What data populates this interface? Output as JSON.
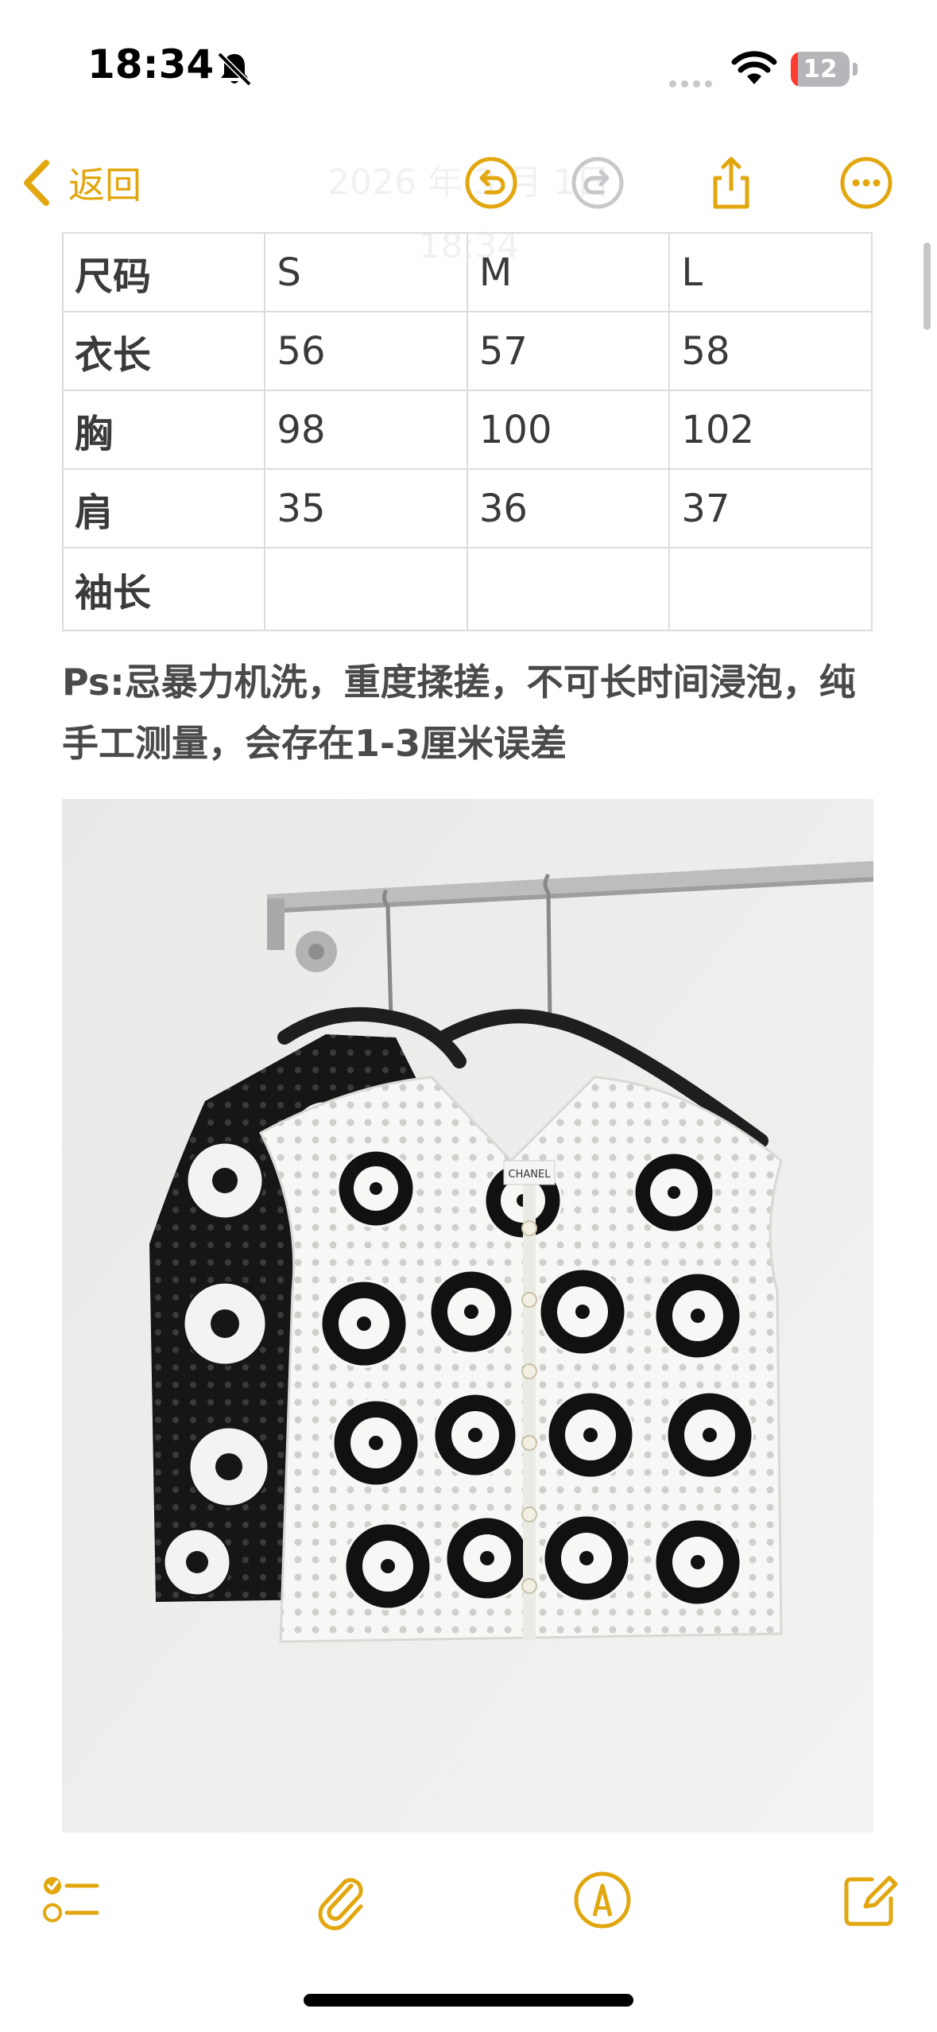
{
  "status_bar": {
    "time": "18:34",
    "battery_level": "12",
    "battery_fraction": 0.12,
    "icons": [
      "bell-slash-icon",
      "cellular-signal-icon",
      "wifi-icon",
      "battery-icon"
    ]
  },
  "nav": {
    "back_label": "返回",
    "faded_date": "2026 年 3 月 1日 18:34",
    "icons": [
      "undo-icon",
      "redo-icon",
      "share-icon",
      "more-icon"
    ]
  },
  "size_table": {
    "header": [
      "尺码",
      "S",
      "M",
      "L"
    ],
    "rows": [
      [
        "衣长",
        "56",
        "57",
        "58"
      ],
      [
        "胸",
        "98",
        "100",
        "102"
      ],
      [
        "肩",
        "35",
        "36",
        "37"
      ],
      [
        "袖长",
        "",
        "",
        ""
      ]
    ]
  },
  "note": {
    "text": "Ps:忌暴力机洗，重度揉搓，不可长时间浸泡，纯手工测量，会存在1-3厘米误差"
  },
  "photo": {
    "label_text": "CHANEL"
  },
  "toolbar": {
    "icons": [
      "checklist-icon",
      "paperclip-icon",
      "markup-pen-icon",
      "compose-icon"
    ]
  },
  "colors": {
    "accent": "#e2a70e",
    "text": "#3a3a3c",
    "border": "#dcdcde"
  }
}
